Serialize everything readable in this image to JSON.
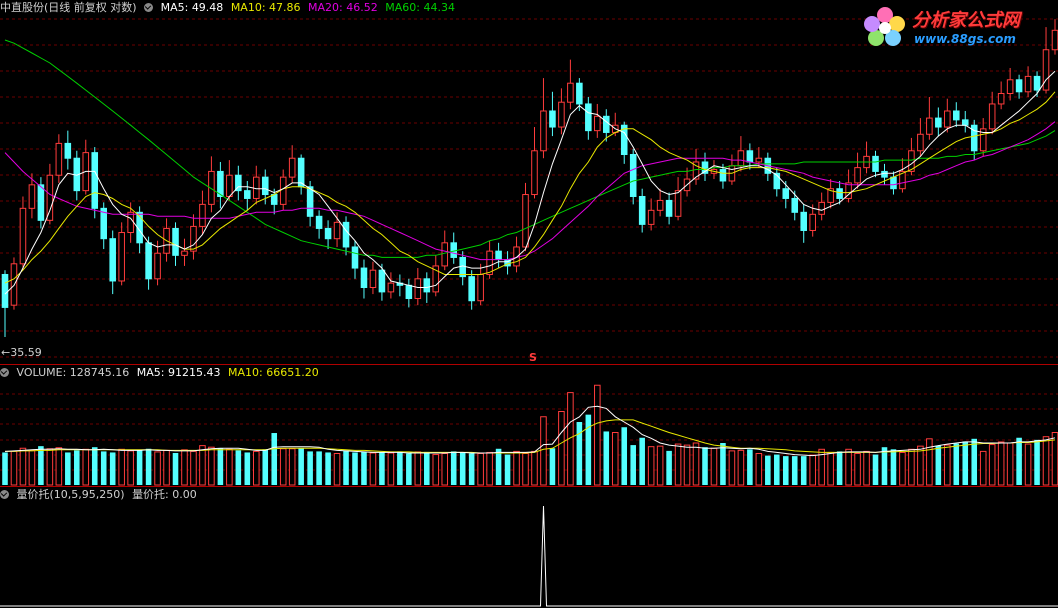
{
  "price_panel": {
    "stock_name": "中直股份",
    "mode": "(日线 前复权 对数)",
    "ma_labels": [
      {
        "label": "MA5:",
        "value": "49.48",
        "color": "#ffffff"
      },
      {
        "label": "MA10:",
        "value": "47.86",
        "color": "#e8e800"
      },
      {
        "label": "MA20:",
        "value": "46.52",
        "color": "#e000e0"
      },
      {
        "label": "MA60:",
        "value": "44.34",
        "color": "#00d000"
      }
    ],
    "low_marker": "35.59",
    "signal_marker": "S"
  },
  "volume_panel": {
    "title": "VOLUME:",
    "value": "128745.16",
    "ma5_label": "MA5:",
    "ma5_value": "91215.43",
    "ma10_label": "MA10:",
    "ma10_value": "66651.20"
  },
  "indicator_panel": {
    "title": "量价托(10,5,95,250)",
    "value_label": "量价托:",
    "value": "0.00"
  },
  "logo": {
    "title": "分析家公式网",
    "url": "www.88gs.com"
  },
  "colors": {
    "up": "#ff3c3c",
    "down": "#54ffff",
    "grid": "#6b0000",
    "ma5": "#ffffff",
    "ma10": "#e8e800",
    "ma20": "#e000e0",
    "ma60": "#00d000"
  },
  "chart_data": {
    "type": "candlestick",
    "price_scale": "log",
    "ylim": [
      34.5,
      52.5
    ],
    "candles": [
      [
        38.4,
        36.9,
        38.6,
        35.6
      ],
      [
        37.0,
        38.9,
        39.2,
        36.8
      ],
      [
        38.9,
        41.6,
        42.2,
        38.6
      ],
      [
        41.6,
        42.8,
        43.4,
        41.1
      ],
      [
        42.8,
        41.0,
        43.2,
        40.6
      ],
      [
        41.0,
        43.3,
        43.9,
        40.8
      ],
      [
        43.3,
        45.0,
        45.5,
        42.9
      ],
      [
        45.0,
        44.2,
        45.7,
        43.6
      ],
      [
        44.2,
        42.5,
        44.6,
        42.0
      ],
      [
        42.5,
        44.5,
        45.2,
        42.3
      ],
      [
        44.5,
        41.6,
        44.8,
        41.1
      ],
      [
        41.6,
        40.1,
        41.9,
        39.6
      ],
      [
        40.1,
        38.1,
        40.5,
        37.5
      ],
      [
        38.1,
        40.4,
        40.9,
        37.9
      ],
      [
        40.4,
        41.4,
        41.9,
        39.9
      ],
      [
        41.4,
        39.9,
        41.7,
        39.4
      ],
      [
        39.9,
        38.2,
        40.2,
        37.7
      ],
      [
        38.2,
        39.4,
        40.0,
        37.9
      ],
      [
        39.4,
        40.6,
        41.1,
        39.0
      ],
      [
        40.6,
        39.3,
        40.9,
        38.8
      ],
      [
        39.3,
        39.5,
        40.1,
        38.8
      ],
      [
        39.5,
        40.7,
        41.3,
        39.1
      ],
      [
        40.7,
        41.8,
        42.5,
        40.3
      ],
      [
        41.8,
        43.5,
        44.3,
        41.4
      ],
      [
        43.5,
        42.2,
        44.0,
        41.6
      ],
      [
        42.2,
        43.3,
        44.1,
        42.0
      ],
      [
        43.3,
        42.5,
        43.8,
        42.0
      ],
      [
        42.5,
        42.1,
        43.0,
        41.5
      ],
      [
        42.1,
        43.2,
        43.8,
        41.8
      ],
      [
        43.2,
        42.3,
        43.6,
        41.8
      ],
      [
        42.3,
        41.8,
        42.6,
        41.3
      ],
      [
        41.8,
        43.2,
        43.6,
        41.5
      ],
      [
        43.2,
        44.2,
        44.9,
        42.9
      ],
      [
        44.2,
        42.7,
        44.4,
        42.3
      ],
      [
        42.7,
        41.2,
        43.0,
        40.7
      ],
      [
        41.2,
        40.6,
        41.5,
        40.1
      ],
      [
        40.6,
        40.1,
        41.0,
        39.6
      ],
      [
        40.1,
        40.9,
        41.4,
        39.7
      ],
      [
        40.9,
        39.7,
        41.2,
        39.3
      ],
      [
        39.7,
        38.7,
        40.0,
        38.2
      ],
      [
        38.7,
        37.8,
        39.1,
        37.3
      ],
      [
        37.8,
        38.6,
        39.0,
        37.5
      ],
      [
        38.6,
        37.6,
        38.9,
        37.2
      ],
      [
        37.6,
        38.0,
        38.5,
        37.3
      ],
      [
        38.0,
        37.9,
        38.4,
        37.4
      ],
      [
        37.9,
        37.3,
        38.2,
        36.9
      ],
      [
        37.3,
        38.2,
        38.7,
        37.0
      ],
      [
        38.2,
        37.6,
        38.5,
        37.1
      ],
      [
        37.6,
        38.8,
        39.3,
        37.4
      ],
      [
        38.8,
        39.9,
        40.5,
        38.6
      ],
      [
        39.9,
        39.2,
        40.4,
        38.9
      ],
      [
        39.2,
        38.3,
        39.5,
        37.9
      ],
      [
        38.3,
        37.2,
        38.6,
        36.8
      ],
      [
        37.2,
        38.4,
        38.9,
        37.0
      ],
      [
        38.4,
        39.5,
        40.0,
        38.2
      ],
      [
        39.5,
        39.1,
        39.9,
        38.7
      ],
      [
        39.1,
        38.8,
        39.5,
        38.4
      ],
      [
        38.8,
        39.7,
        40.2,
        38.5
      ],
      [
        39.7,
        42.3,
        42.9,
        39.5
      ],
      [
        42.3,
        44.6,
        45.9,
        42.1
      ],
      [
        44.6,
        46.8,
        48.7,
        44.2
      ],
      [
        46.8,
        45.9,
        47.9,
        45.4
      ],
      [
        45.9,
        47.3,
        48.1,
        45.5
      ],
      [
        47.3,
        48.4,
        49.8,
        46.9
      ],
      [
        48.4,
        47.2,
        48.7,
        46.8
      ],
      [
        47.2,
        45.7,
        47.6,
        45.2
      ],
      [
        45.7,
        46.5,
        47.2,
        45.3
      ],
      [
        46.5,
        45.6,
        46.9,
        45.1
      ],
      [
        45.6,
        46.0,
        46.7,
        45.4
      ],
      [
        46.0,
        44.4,
        46.2,
        43.9
      ],
      [
        44.4,
        42.2,
        44.7,
        41.8
      ],
      [
        42.2,
        40.8,
        42.6,
        40.4
      ],
      [
        40.8,
        41.5,
        42.1,
        40.5
      ],
      [
        41.5,
        42.0,
        42.6,
        41.2
      ],
      [
        42.0,
        41.2,
        42.4,
        40.8
      ],
      [
        41.2,
        42.5,
        43.2,
        41.0
      ],
      [
        42.5,
        43.1,
        43.7,
        42.2
      ],
      [
        43.1,
        44.0,
        44.7,
        42.8
      ],
      [
        44.0,
        43.4,
        44.5,
        43.0
      ],
      [
        43.4,
        43.6,
        44.1,
        43.1
      ],
      [
        43.6,
        43.0,
        43.9,
        42.6
      ],
      [
        43.0,
        43.8,
        44.4,
        42.8
      ],
      [
        43.8,
        44.6,
        45.4,
        43.5
      ],
      [
        44.6,
        44.0,
        45.0,
        43.6
      ],
      [
        44.0,
        44.2,
        44.8,
        43.7
      ],
      [
        44.2,
        43.4,
        44.5,
        43.0
      ],
      [
        43.4,
        42.6,
        43.7,
        42.2
      ],
      [
        42.6,
        42.1,
        43.0,
        41.6
      ],
      [
        42.1,
        41.4,
        42.5,
        41.0
      ],
      [
        41.4,
        40.5,
        41.8,
        39.9
      ],
      [
        40.5,
        41.3,
        41.8,
        40.2
      ],
      [
        41.3,
        41.9,
        42.4,
        41.0
      ],
      [
        41.9,
        42.6,
        43.1,
        41.6
      ],
      [
        42.6,
        42.1,
        43.0,
        41.8
      ],
      [
        42.1,
        42.9,
        43.6,
        41.9
      ],
      [
        42.9,
        43.7,
        44.5,
        42.6
      ],
      [
        43.7,
        44.3,
        45.1,
        43.4
      ],
      [
        44.3,
        43.5,
        44.6,
        43.2
      ],
      [
        43.5,
        43.2,
        43.9,
        42.8
      ],
      [
        43.2,
        42.6,
        43.5,
        42.3
      ],
      [
        42.6,
        43.5,
        44.2,
        42.4
      ],
      [
        43.5,
        44.6,
        45.3,
        43.3
      ],
      [
        44.6,
        45.5,
        46.4,
        44.3
      ],
      [
        45.5,
        46.4,
        47.6,
        45.2
      ],
      [
        46.4,
        45.9,
        47.0,
        45.4
      ],
      [
        45.9,
        46.8,
        47.5,
        45.6
      ],
      [
        46.8,
        46.3,
        47.3,
        45.9
      ],
      [
        46.3,
        46.0,
        46.8,
        45.6
      ],
      [
        46.0,
        44.6,
        46.3,
        44.1
      ],
      [
        44.6,
        45.8,
        46.4,
        44.3
      ],
      [
        45.8,
        47.2,
        47.9,
        45.5
      ],
      [
        47.2,
        47.8,
        48.5,
        46.9
      ],
      [
        47.8,
        48.6,
        49.3,
        47.4
      ],
      [
        48.6,
        47.9,
        48.9,
        47.5
      ],
      [
        47.9,
        48.8,
        49.4,
        47.6
      ],
      [
        48.8,
        48.0,
        49.1,
        47.6
      ],
      [
        48.0,
        50.4,
        51.8,
        47.8
      ],
      [
        50.4,
        51.6,
        52.3,
        50.1
      ]
    ],
    "ma5": [
      37.5,
      37.9,
      38.7,
      39.6,
      40.4,
      41.5,
      42.8,
      43.4,
      43.3,
      43.5,
      43.5,
      42.6,
      41.8,
      41.3,
      41.1,
      40.5,
      39.9,
      39.7,
      39.8,
      39.8,
      39.6,
      39.8,
      40.3,
      41.1,
      41.5,
      42.2,
      42.7,
      42.7,
      42.6,
      42.6,
      42.4,
      42.6,
      42.9,
      42.9,
      42.6,
      42.3,
      41.7,
      41.1,
      40.5,
      40.0,
      39.4,
      39.1,
      38.7,
      38.1,
      38.0,
      37.9,
      37.8,
      37.8,
      37.9,
      38.3,
      38.7,
      38.8,
      38.7,
      38.7,
      38.8,
      39.0,
      39.0,
      39.2,
      39.6,
      40.8,
      42.4,
      43.9,
      45.2,
      46.6,
      47.1,
      46.7,
      46.6,
      46.2,
      45.8,
      45.6,
      44.8,
      43.9,
      43.0,
      42.5,
      42.3,
      42.4,
      42.8,
      43.2,
      43.5,
      43.8,
      43.7,
      43.6,
      43.7,
      43.8,
      43.8,
      43.6,
      43.3,
      42.8,
      42.3,
      41.8,
      41.6,
      41.5,
      41.7,
      41.9,
      42.3,
      42.7,
      43.1,
      43.3,
      43.4,
      43.4,
      43.6,
      43.9,
      44.3,
      44.9,
      45.4,
      45.8,
      46.0,
      46.0,
      45.7,
      45.6,
      45.6,
      46.0,
      46.4,
      46.8,
      47.3,
      47.8,
      48.6,
      49.1
    ],
    "ma10": [
      38.0,
      38.2,
      38.6,
      39.1,
      39.5,
      40.0,
      40.6,
      41.2,
      41.7,
      42.2,
      42.4,
      42.3,
      42.1,
      41.8,
      41.6,
      41.2,
      40.7,
      40.3,
      40.0,
      39.8,
      39.6,
      39.6,
      39.8,
      40.2,
      40.6,
      40.9,
      41.2,
      41.5,
      41.9,
      42.1,
      42.3,
      42.6,
      42.7,
      42.7,
      42.6,
      42.4,
      42.2,
      41.9,
      41.7,
      41.4,
      41.0,
      40.6,
      40.3,
      39.9,
      39.5,
      39.3,
      39.0,
      38.8,
      38.6,
      38.4,
      38.4,
      38.4,
      38.4,
      38.4,
      38.5,
      38.7,
      38.9,
      39.0,
      39.2,
      39.7,
      40.3,
      41.0,
      41.7,
      42.6,
      43.4,
      44.0,
      44.8,
      45.3,
      45.6,
      45.8,
      45.8,
      45.5,
      45.2,
      44.8,
      44.5,
      44.3,
      44.1,
      43.8,
      43.6,
      43.5,
      43.4,
      43.4,
      43.6,
      43.7,
      43.7,
      43.7,
      43.6,
      43.5,
      43.3,
      43.1,
      42.9,
      42.7,
      42.5,
      42.4,
      42.4,
      42.5,
      42.6,
      42.8,
      43.0,
      43.2,
      43.4,
      43.6,
      43.9,
      44.2,
      44.5,
      44.8,
      45.1,
      45.3,
      45.4,
      45.5,
      45.6,
      45.8,
      46.1,
      46.3,
      46.6,
      46.9,
      47.3,
      47.9
    ],
    "ma20": [
      44.5,
      44.0,
      43.5,
      43.1,
      42.7,
      42.3,
      42.1,
      41.9,
      41.7,
      41.6,
      41.5,
      41.4,
      41.3,
      41.3,
      41.3,
      41.3,
      41.3,
      41.2,
      41.2,
      41.2,
      41.2,
      41.1,
      41.1,
      41.1,
      41.1,
      41.1,
      41.2,
      41.3,
      41.4,
      41.4,
      41.4,
      41.5,
      41.5,
      41.6,
      41.6,
      41.6,
      41.5,
      41.5,
      41.4,
      41.3,
      41.2,
      41.0,
      40.8,
      40.6,
      40.4,
      40.2,
      40.0,
      39.8,
      39.6,
      39.5,
      39.4,
      39.3,
      39.2,
      39.1,
      39.1,
      39.1,
      39.1,
      39.2,
      39.3,
      39.5,
      39.8,
      40.1,
      40.5,
      40.9,
      41.3,
      41.7,
      42.2,
      42.6,
      43.0,
      43.4,
      43.6,
      43.8,
      43.9,
      44.0,
      44.1,
      44.2,
      44.2,
      44.2,
      44.2,
      44.2,
      44.2,
      44.1,
      44.1,
      44.0,
      43.9,
      43.8,
      43.7,
      43.6,
      43.5,
      43.4,
      43.2,
      43.1,
      43.0,
      42.9,
      42.8,
      42.8,
      42.8,
      42.8,
      42.8,
      42.8,
      42.9,
      43.0,
      43.1,
      43.3,
      43.4,
      43.6,
      43.8,
      44.0,
      44.1,
      44.3,
      44.4,
      44.6,
      44.8,
      45.0,
      45.2,
      45.5,
      45.8,
      46.2
    ],
    "ma60": [
      51.0,
      50.8,
      50.5,
      50.2,
      49.9,
      49.6,
      49.2,
      48.8,
      48.4,
      48.0,
      47.6,
      47.2,
      46.8,
      46.4,
      46.0,
      45.6,
      45.2,
      44.8,
      44.4,
      44.0,
      43.6,
      43.2,
      42.9,
      42.6,
      42.3,
      42.0,
      41.7,
      41.4,
      41.1,
      40.8,
      40.6,
      40.4,
      40.2,
      40.0,
      39.9,
      39.8,
      39.7,
      39.6,
      39.5,
      39.4,
      39.3,
      39.3,
      39.2,
      39.2,
      39.2,
      39.2,
      39.2,
      39.3,
      39.3,
      39.4,
      39.5,
      39.6,
      39.7,
      39.8,
      40.0,
      40.1,
      40.3,
      40.4,
      40.6,
      40.8,
      41.0,
      41.2,
      41.4,
      41.6,
      41.8,
      42.0,
      42.2,
      42.4,
      42.6,
      42.8,
      43.0,
      43.1,
      43.2,
      43.3,
      43.4,
      43.5,
      43.5,
      43.6,
      43.6,
      43.7,
      43.7,
      43.8,
      43.8,
      43.8,
      43.9,
      43.9,
      43.9,
      43.9,
      43.9,
      44.0,
      44.0,
      44.0,
      44.0,
      44.0,
      44.0,
      44.0,
      44.0,
      44.0,
      44.1,
      44.1,
      44.1,
      44.1,
      44.2,
      44.2,
      44.2,
      44.3,
      44.3,
      44.4,
      44.4,
      44.5,
      44.6,
      44.7,
      44.8,
      44.9,
      45.0,
      45.2,
      45.4,
      45.7
    ],
    "volumes": [
      62,
      64,
      70,
      66,
      74,
      69,
      71,
      62,
      66,
      68,
      72,
      64,
      62,
      68,
      65,
      66,
      69,
      63,
      66,
      61,
      67,
      64,
      75,
      72,
      70,
      68,
      66,
      62,
      64,
      68,
      99,
      69,
      69,
      70,
      64,
      64,
      62,
      60,
      65,
      62,
      63,
      61,
      62,
      61,
      64,
      60,
      63,
      63,
      58,
      60,
      64,
      62,
      60,
      60,
      62,
      69,
      58,
      64,
      60,
      64,
      130,
      70,
      140,
      176,
      120,
      134,
      190,
      102,
      100,
      110,
      76,
      90,
      73,
      74,
      65,
      78,
      76,
      80,
      72,
      70,
      80,
      65,
      66,
      68,
      60,
      56,
      58,
      55,
      55,
      55,
      57,
      68,
      62,
      64,
      68,
      60,
      64,
      58,
      72,
      68,
      62,
      68,
      74,
      88,
      75,
      76,
      79,
      83,
      88,
      64,
      77,
      82,
      80,
      90,
      78,
      86,
      92,
      100
    ],
    "volume_ma5": [
      64,
      65,
      66,
      67,
      68,
      68,
      69,
      68,
      68,
      67,
      67,
      68,
      67,
      66,
      66,
      66,
      67,
      66,
      66,
      65,
      65,
      65,
      67,
      69,
      70,
      70,
      70,
      68,
      66,
      66,
      72,
      73,
      73,
      73,
      73,
      72,
      68,
      66,
      65,
      64,
      63,
      62,
      62,
      62,
      62,
      61,
      61,
      61,
      61,
      61,
      62,
      62,
      61,
      61,
      61,
      62,
      62,
      62,
      62,
      63,
      77,
      78,
      100,
      120,
      130,
      148,
      150,
      146,
      130,
      120,
      110,
      96,
      89,
      80,
      76,
      74,
      72,
      72,
      70,
      70,
      71,
      70,
      69,
      70,
      68,
      64,
      62,
      60,
      58,
      57,
      56,
      58,
      60,
      62,
      63,
      63,
      63,
      62,
      64,
      65,
      66,
      67,
      68,
      72,
      75,
      78,
      80,
      82,
      82,
      80,
      80,
      80,
      80,
      82,
      82,
      84,
      86,
      90
    ],
    "volume_ma10": [
      64,
      64,
      65,
      65,
      66,
      66,
      67,
      67,
      67,
      67,
      67,
      67,
      67,
      67,
      67,
      67,
      67,
      67,
      66,
      66,
      66,
      66,
      66,
      67,
      67,
      67,
      67,
      67,
      67,
      67,
      69,
      70,
      70,
      70,
      70,
      70,
      69,
      68,
      67,
      66,
      66,
      65,
      64,
      63,
      63,
      63,
      62,
      62,
      62,
      62,
      62,
      62,
      62,
      61,
      61,
      61,
      61,
      61,
      61,
      62,
      68,
      70,
      80,
      90,
      98,
      110,
      118,
      122,
      124,
      124,
      124,
      118,
      112,
      106,
      100,
      95,
      90,
      85,
      80,
      76,
      74,
      72,
      70,
      70,
      70,
      69,
      68,
      67,
      65,
      64,
      63,
      62,
      62,
      62,
      62,
      62,
      62,
      62,
      63,
      63,
      64,
      64,
      65,
      67,
      70,
      72,
      74,
      76,
      78,
      79,
      79,
      80,
      80,
      81,
      81,
      82,
      84,
      86
    ],
    "indicator": {
      "spike_index": 60,
      "value": 0.0
    }
  }
}
